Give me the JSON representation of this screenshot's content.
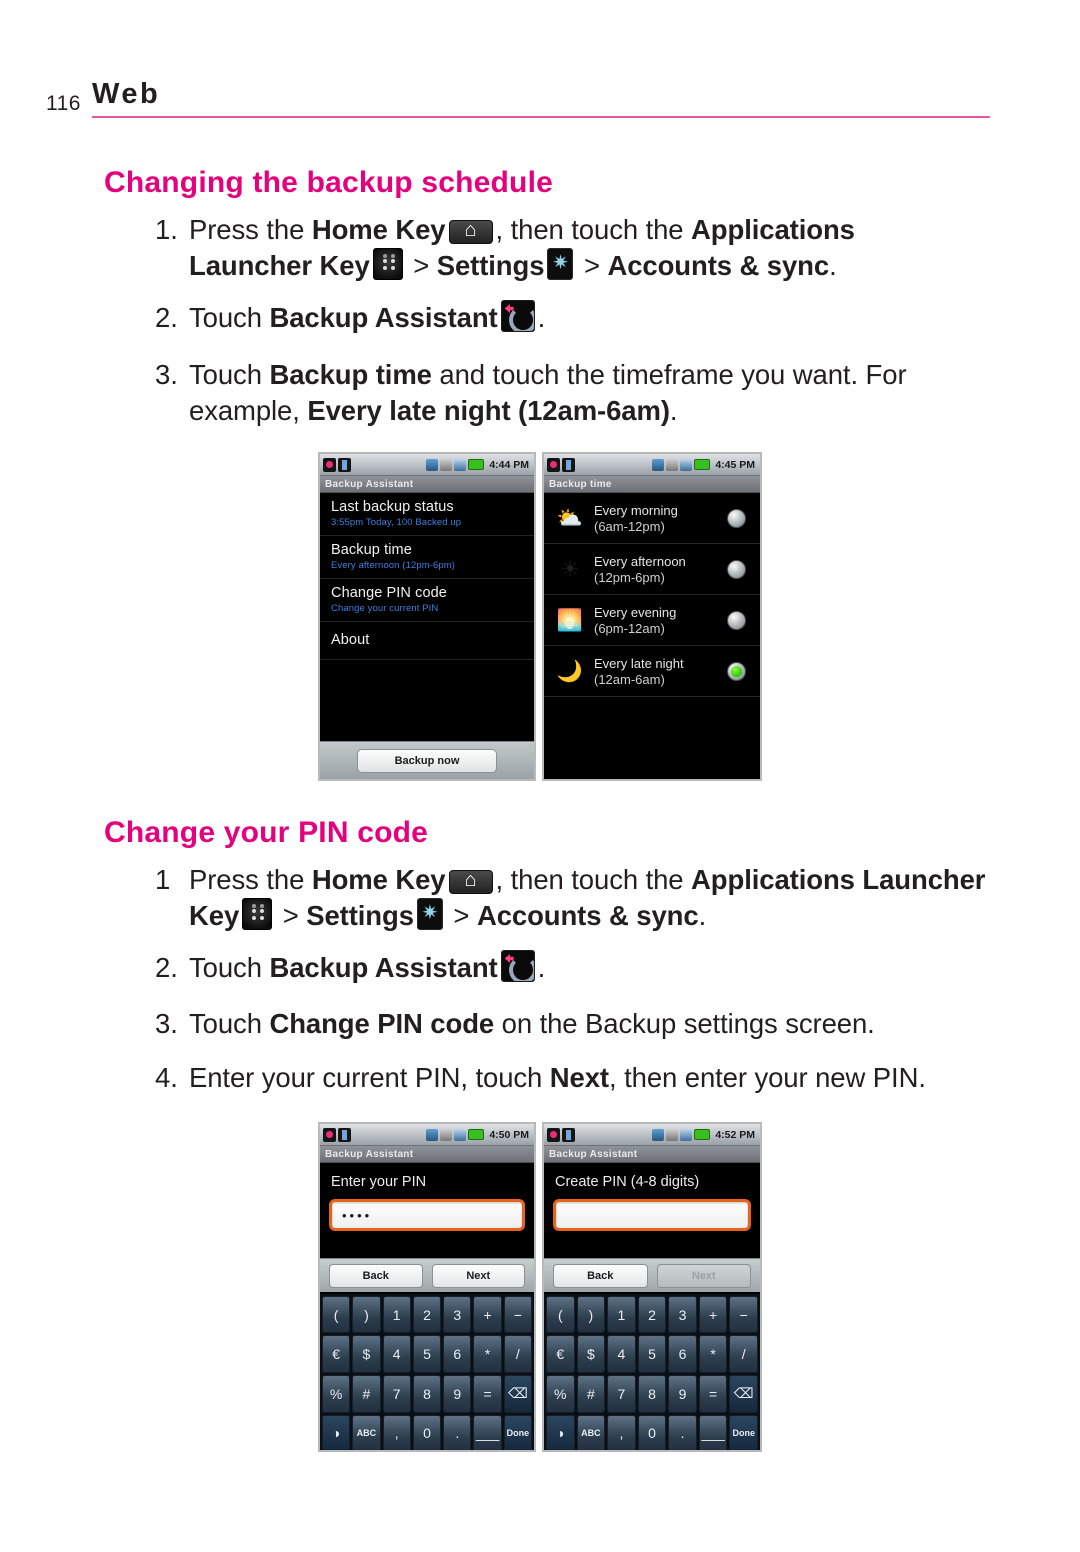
{
  "page": {
    "number": "116",
    "section": "Web",
    "rule_color": "#ef559f",
    "accent_color": "#e5007e"
  },
  "sections": [
    {
      "heading": "Changing the backup schedule",
      "steps": [
        {
          "number": "1.",
          "parts": [
            {
              "t": "Press the ",
              "b": false
            },
            {
              "t": "Home Key",
              "b": true
            },
            {
              "icon": "home-key-icon"
            },
            {
              "t": ", then touch the ",
              "b": false
            },
            {
              "t": "Applications Launcher Key",
              "b": true
            },
            {
              "icon": "applications-launcher-key-icon"
            },
            {
              "t": " > ",
              "b": false
            },
            {
              "t": "Settings",
              "b": true
            },
            {
              "icon": "settings-gear-icon"
            },
            {
              "t": " > ",
              "b": false
            },
            {
              "t": "Accounts & sync",
              "b": true
            },
            {
              "t": ".",
              "b": false
            }
          ]
        },
        {
          "number": "2.",
          "parts": [
            {
              "t": "Touch ",
              "b": false
            },
            {
              "t": "Backup Assistant",
              "b": true
            },
            {
              "icon": "backup-assistant-icon"
            },
            {
              "t": ".",
              "b": false
            }
          ]
        },
        {
          "number": "3.",
          "parts": [
            {
              "t": "Touch ",
              "b": false
            },
            {
              "t": "Backup time",
              "b": true
            },
            {
              "t": " and touch the timeframe you want. For example, ",
              "b": false
            },
            {
              "t": "Every late night (12am-6am)",
              "b": true
            },
            {
              "t": ".",
              "b": false
            }
          ]
        }
      ]
    },
    {
      "heading": "Change your PIN code",
      "steps": [
        {
          "number": "1",
          "parts": [
            {
              "t": "Press the ",
              "b": false
            },
            {
              "t": "Home Key",
              "b": true
            },
            {
              "icon": "home-key-icon"
            },
            {
              "t": ", then touch the ",
              "b": false
            },
            {
              "t": "Applications Launcher Key",
              "b": true
            },
            {
              "icon": "applications-launcher-key-icon"
            },
            {
              "t": " > ",
              "b": false
            },
            {
              "t": "Settings",
              "b": true
            },
            {
              "icon": "settings-gear-icon"
            },
            {
              "t": " > ",
              "b": false
            },
            {
              "t": "Accounts & sync",
              "b": true
            },
            {
              "t": ".",
              "b": false
            }
          ]
        },
        {
          "number": "2.",
          "parts": [
            {
              "t": "Touch ",
              "b": false
            },
            {
              "t": "Backup Assistant",
              "b": true
            },
            {
              "icon": "backup-assistant-icon"
            },
            {
              "t": ".",
              "b": false
            }
          ]
        },
        {
          "number": "3.",
          "parts": [
            {
              "t": "Touch ",
              "b": false
            },
            {
              "t": "Change PIN code",
              "b": true
            },
            {
              "t": " on the Backup settings screen.",
              "b": false
            }
          ]
        },
        {
          "number": "4.",
          "parts": [
            {
              "t": "Enter your current PIN, touch ",
              "b": false
            },
            {
              "t": "Next",
              "b": true
            },
            {
              "t": ", then enter your new PIN.",
              "b": false
            }
          ]
        }
      ]
    }
  ],
  "screenshots": {
    "backup_assistant_settings": {
      "status_time": "4:44 PM",
      "title": "Backup Assistant",
      "rows": [
        {
          "title": "Last backup status",
          "sub": "3:55pm Today, 100 Backed up"
        },
        {
          "title": "Backup time",
          "sub": "Every afternoon (12pm-6pm)"
        },
        {
          "title": "Change PIN code",
          "sub": "Change your current PIN"
        },
        {
          "title": "About",
          "sub": ""
        }
      ],
      "action_button": "Backup now"
    },
    "backup_time": {
      "status_time": "4:45 PM",
      "title": "Backup time",
      "options": [
        {
          "icon": "sun-cloud-icon",
          "glyph": "⛅",
          "line1": "Every morning",
          "line2": "(6am-12pm)",
          "selected": false
        },
        {
          "icon": "sun-icon",
          "glyph": "☀",
          "line1": "Every afternoon",
          "line2": "(12pm-6pm)",
          "selected": false
        },
        {
          "icon": "sunset-icon",
          "glyph": "🌅",
          "line1": "Every evening",
          "line2": "(6pm-12am)",
          "selected": false
        },
        {
          "icon": "moon-icon",
          "glyph": "🌙",
          "line1": "Every late night",
          "line2": "(12am-6am)",
          "selected": true
        }
      ]
    },
    "enter_pin": {
      "status_time": "4:50 PM",
      "title": "Backup Assistant",
      "label": "Enter your PIN",
      "field_value": "••••",
      "back_label": "Back",
      "next_label": "Next",
      "next_disabled": false
    },
    "create_pin": {
      "status_time": "4:52 PM",
      "title": "Backup Assistant",
      "label": "Create PIN (4-8 digits)",
      "field_value": "",
      "back_label": "Back",
      "next_label": "Next",
      "next_disabled": true
    },
    "keypad_rows": [
      [
        "(",
        ")",
        "1",
        "2",
        "3",
        "+",
        "−"
      ],
      [
        "€",
        "$",
        "4",
        "5",
        "6",
        "*",
        "/"
      ],
      [
        "%",
        "#",
        "7",
        "8",
        "9",
        "=",
        "⌫"
      ],
      [
        "◑",
        "ABC",
        ",",
        "0",
        ".",
        "___",
        "Done"
      ]
    ]
  }
}
